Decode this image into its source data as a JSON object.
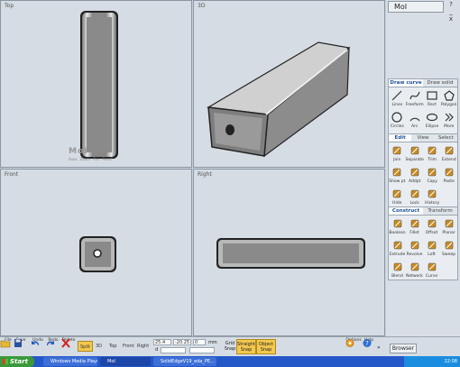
{
  "viewports": {
    "top": {
      "label": "Top"
    },
    "threed": {
      "label": "3D"
    },
    "front": {
      "label": "Front"
    },
    "right": {
      "label": "Right"
    }
  },
  "viewcube": {
    "logo": "MoI",
    "nav": [
      "Axes",
      "Zoom",
      "Pan",
      "Reset"
    ]
  },
  "panel": {
    "title": "MoI",
    "window_buttons": [
      "?",
      "_",
      "x"
    ],
    "draw_tabs": [
      "Draw curve",
      "Draw solid"
    ],
    "draw_tools": [
      "Lines",
      "Freeform",
      "Rect",
      "Polygon",
      "Circles",
      "Arc",
      "Ellipse",
      "More"
    ],
    "edit_tabs": [
      "Edit",
      "View",
      "Select"
    ],
    "edit_tools": [
      "Join",
      "Separate",
      "Trim",
      "Extend",
      "Show pt",
      "Addpt",
      "Copy",
      "Paste",
      "Hide",
      "Lock",
      "History"
    ],
    "construct_tabs": [
      "Construct",
      "Transform"
    ],
    "construct_tools": [
      "Boolean",
      "Fillet",
      "Offset",
      "Planar",
      "Extrude",
      "Revolve",
      "Loft",
      "Sweep",
      "Blend",
      "Network",
      "Curve"
    ]
  },
  "bottombar": {
    "file_buttons": [
      "File",
      "Save",
      "Undo",
      "Redo",
      "Delete"
    ],
    "view_buttons": [
      "Split",
      "3D",
      "Top",
      "Front",
      "Right"
    ],
    "coords": {
      "x": "25.4",
      "y": "-20.25",
      "z": "0",
      "d": "d",
      "unit": "mm"
    },
    "snaps": [
      "Grid Snap",
      "Straight Snap",
      "Object Snap"
    ],
    "right_buttons": [
      "Options",
      "Help"
    ],
    "browser": "Browser"
  },
  "taskbar": {
    "start": "Start",
    "tasks": [
      "Windows Media Player",
      "MoI",
      "SolidEdgeV19_eda_PE..."
    ],
    "time": "22:08"
  }
}
